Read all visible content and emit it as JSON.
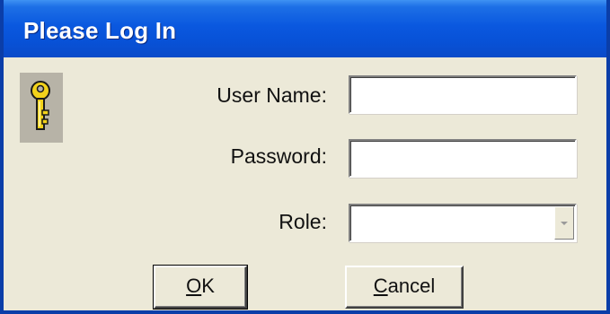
{
  "window": {
    "title": "Please Log In"
  },
  "form": {
    "username_label": "User Name:",
    "username_value": "",
    "password_label": "Password:",
    "password_value": "",
    "role_label": "Role:",
    "role_value": ""
  },
  "buttons": {
    "ok_mnemonic": "O",
    "ok_rest": "K",
    "cancel_mnemonic": "C",
    "cancel_rest": "ancel"
  },
  "icons": {
    "key": "key-icon",
    "dropdown": "chevron-down-icon"
  },
  "colors": {
    "titlebar": "#0a58df",
    "dialog_bg": "#ece9d8",
    "key_yellow": "#f2d21b"
  }
}
